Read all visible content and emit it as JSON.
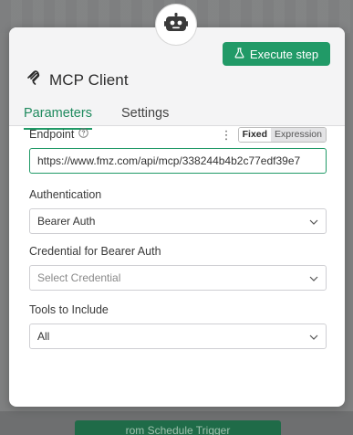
{
  "background": {
    "bottom_button_label": "rom Schedule Trigger"
  },
  "header": {
    "badge_icon": "robot-icon",
    "title": "MCP Client",
    "title_icon": "mcp-logo-icon",
    "execute_label": "Execute step",
    "execute_icon": "flask-icon"
  },
  "tabs": [
    {
      "label": "Parameters",
      "active": true
    },
    {
      "label": "Settings",
      "active": false
    }
  ],
  "fields": {
    "endpoint": {
      "label": "Endpoint",
      "mode_fixed": "Fixed",
      "mode_expression": "Expression",
      "value": "https://www.fmz.com/api/mcp/338244b4b2c77edf39e7"
    },
    "authentication": {
      "label": "Authentication",
      "value": "Bearer Auth"
    },
    "credential": {
      "label": "Credential for Bearer Auth",
      "placeholder": "Select Credential"
    },
    "tools": {
      "label": "Tools to Include",
      "value": "All"
    }
  },
  "colors": {
    "accent": "#219a67",
    "tab_active": "#1f8a5e"
  }
}
